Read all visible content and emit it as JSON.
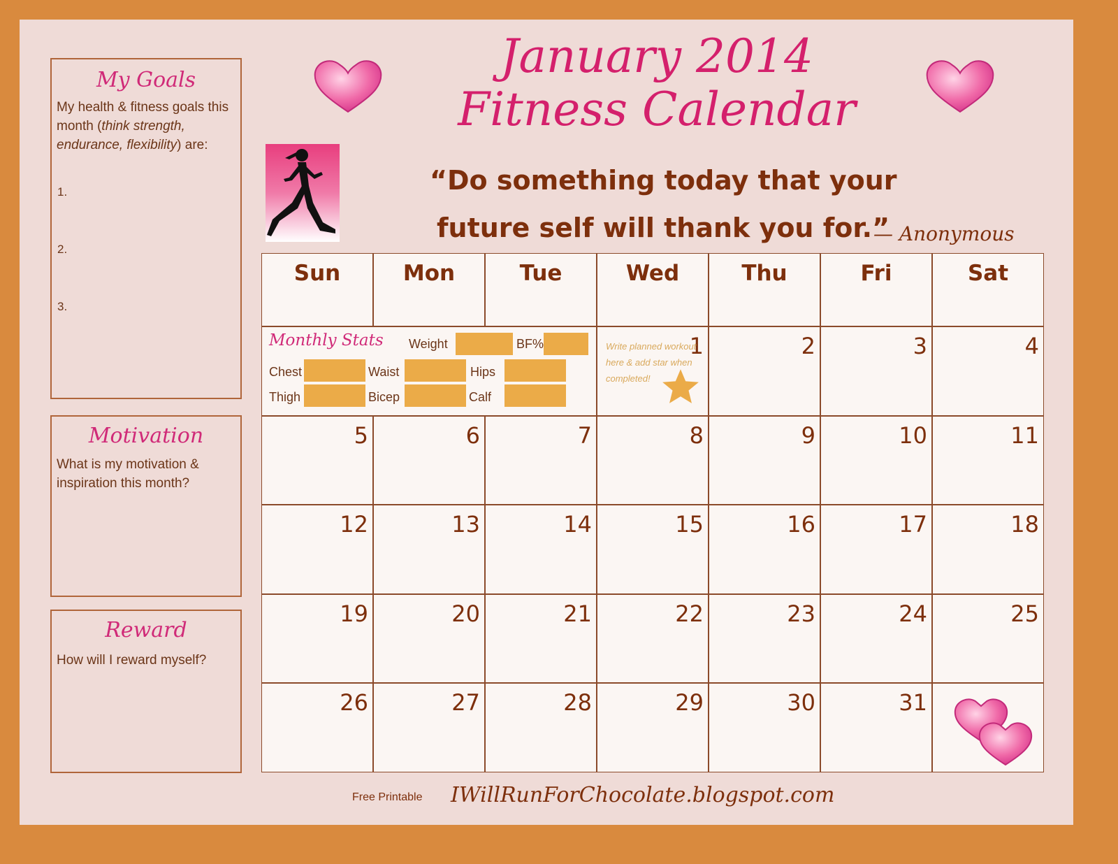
{
  "colors": {
    "border": "#d98a3e",
    "background": "#efdbd7",
    "title": "#d4206c",
    "text": "#7d2f0c",
    "stat_box": "#ebab48"
  },
  "title": {
    "line1": "January 2014",
    "line2": "Fitness Calendar"
  },
  "quote": {
    "line1": "“Do something today that your",
    "line2": "future self will thank you for.”",
    "author": "— Anonymous"
  },
  "goals": {
    "heading": "My Goals",
    "text_plain1": "My health & fitness goals this month (",
    "text_italic": "think strength, endurance, flexibility",
    "text_plain2": ") are:",
    "items": [
      "1.",
      "2.",
      "3."
    ]
  },
  "motivation": {
    "heading": "Motivation",
    "text": "What is my motivation & inspiration this month?"
  },
  "reward": {
    "heading": "Reward",
    "text": "How will I reward myself?"
  },
  "days": [
    "Sun",
    "Mon",
    "Tue",
    "Wed",
    "Thu",
    "Fri",
    "Sat"
  ],
  "stats": {
    "heading": "Monthly Stats",
    "fields": [
      "Weight",
      "BF%",
      "Chest",
      "Waist",
      "Hips",
      "Thigh",
      "Bicep",
      "Calf"
    ]
  },
  "hint": "Write planned workout here & add star when completed!",
  "weeks": [
    [
      null,
      null,
      null,
      1,
      2,
      3,
      4
    ],
    [
      5,
      6,
      7,
      8,
      9,
      10,
      11
    ],
    [
      12,
      13,
      14,
      15,
      16,
      17,
      18
    ],
    [
      19,
      20,
      21,
      22,
      23,
      24,
      25
    ],
    [
      26,
      27,
      28,
      29,
      30,
      31,
      null
    ]
  ],
  "footer": {
    "label": "Free Printable",
    "site": "IWillRunForChocolate.blogspot.com"
  },
  "icons": [
    "heart-icon",
    "runner-icon",
    "star-icon"
  ]
}
